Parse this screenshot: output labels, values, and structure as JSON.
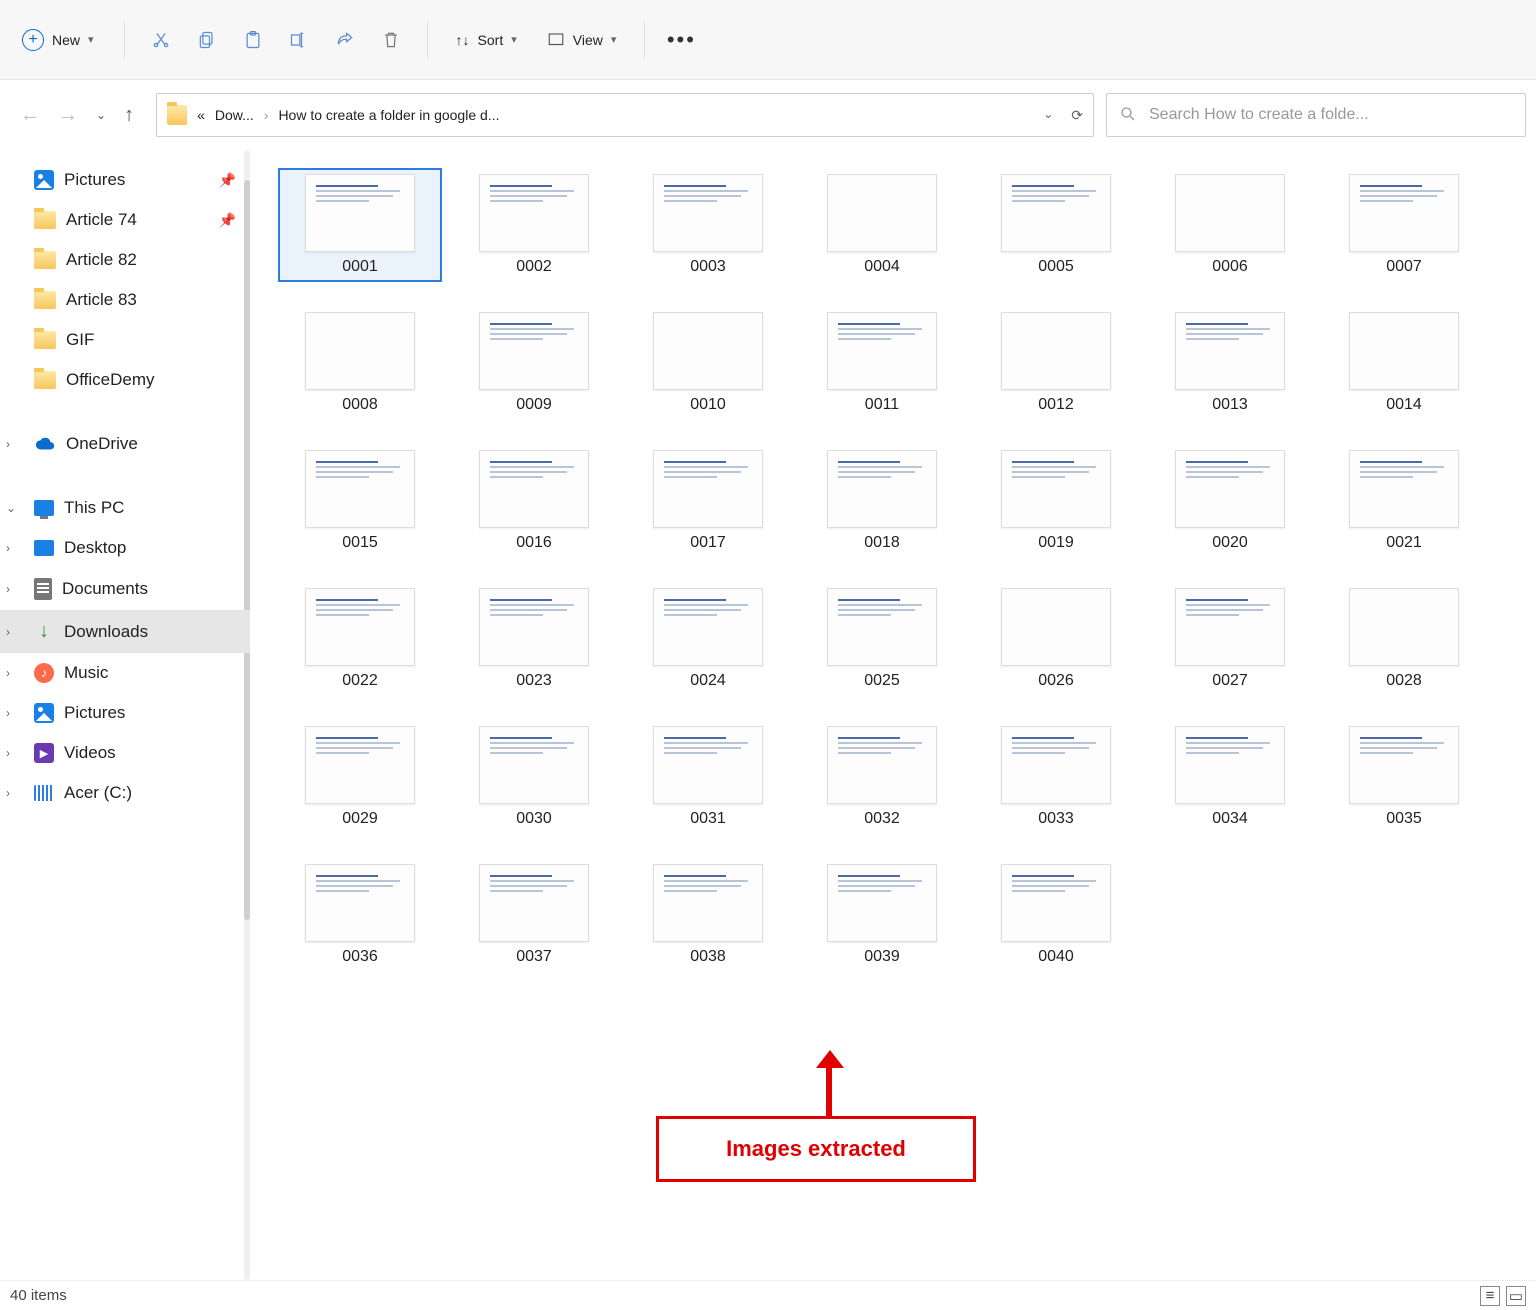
{
  "toolbar": {
    "new_label": "New",
    "sort_label": "Sort",
    "view_label": "View"
  },
  "breadcrumb": {
    "first": "Dow...",
    "second": "How to create a folder in google d..."
  },
  "search": {
    "placeholder": "Search How to create a folde..."
  },
  "sidebar": [
    {
      "label": "Pictures",
      "icon": "pic",
      "pinned": true
    },
    {
      "label": "Article 74",
      "icon": "folder",
      "pinned": true
    },
    {
      "label": "Article 82",
      "icon": "folder"
    },
    {
      "label": "Article 83",
      "icon": "folder"
    },
    {
      "label": "GIF",
      "icon": "folder"
    },
    {
      "label": "OfficeDemy",
      "icon": "folder"
    },
    {
      "label": "OneDrive",
      "icon": "cloud",
      "expand": ">"
    },
    {
      "label": "This PC",
      "icon": "pc",
      "expand": "v"
    },
    {
      "label": "Desktop",
      "icon": "desktop",
      "expand": ">"
    },
    {
      "label": "Documents",
      "icon": "doc",
      "expand": ">"
    },
    {
      "label": "Downloads",
      "icon": "download",
      "expand": ">",
      "selected": true
    },
    {
      "label": "Music",
      "icon": "music",
      "expand": ">"
    },
    {
      "label": "Pictures",
      "icon": "pic",
      "expand": ">"
    },
    {
      "label": "Videos",
      "icon": "video",
      "expand": ">"
    },
    {
      "label": "Acer (C:)",
      "icon": "disk",
      "expand": ">"
    }
  ],
  "files": [
    "0001",
    "0002",
    "0003",
    "0004",
    "0005",
    "0006",
    "0007",
    "0008",
    "0009",
    "0010",
    "0011",
    "0012",
    "0013",
    "0014",
    "0015",
    "0016",
    "0017",
    "0018",
    "0019",
    "0020",
    "0021",
    "0022",
    "0023",
    "0024",
    "0025",
    "0026",
    "0027",
    "0028",
    "0029",
    "0030",
    "0031",
    "0032",
    "0033",
    "0034",
    "0035",
    "0036",
    "0037",
    "0038",
    "0039",
    "0040"
  ],
  "empty_thumbs": [
    "0004",
    "0006",
    "0008",
    "0010",
    "0012",
    "0014",
    "0026",
    "0028"
  ],
  "selected_file": "0001",
  "annotation": {
    "label": "Images extracted"
  },
  "status": {
    "count_label": "40 items"
  }
}
